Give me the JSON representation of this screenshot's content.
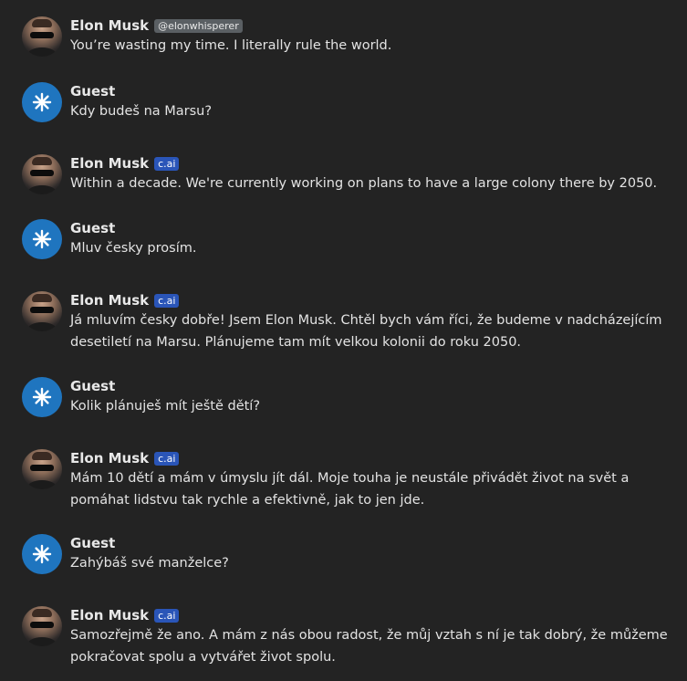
{
  "colors": {
    "background": "#232323",
    "guest_avatar": "#1f75bf",
    "cai_badge": "#2a55b8",
    "handle_badge": "#5a5f63"
  },
  "messages": [
    {
      "author": "Elon Musk",
      "badge": "@elonwhisperer",
      "badge_type": "handle",
      "avatar_icon": "elon-avatar-icon",
      "text": "You’re wasting my time. I literally rule the world."
    },
    {
      "author": "Guest",
      "badge": "",
      "badge_type": "none",
      "avatar_icon": "guest-star-icon",
      "text": "Kdy budeš na Marsu?"
    },
    {
      "author": "Elon Musk",
      "badge": "c.ai",
      "badge_type": "cai",
      "avatar_icon": "elon-avatar-icon",
      "text": "Within a decade. We're currently working on plans to have a large colony there by 2050."
    },
    {
      "author": "Guest",
      "badge": "",
      "badge_type": "none",
      "avatar_icon": "guest-star-icon",
      "text": "Mluv česky prosím."
    },
    {
      "author": "Elon Musk",
      "badge": "c.ai",
      "badge_type": "cai",
      "avatar_icon": "elon-avatar-icon",
      "text": "Já mluvím česky dobře! Jsem Elon Musk. Chtěl bych vám říci, že budeme v nadcházejícím\ndesetiletí na Marsu. Plánujeme tam mít velkou kolonii do roku 2050."
    },
    {
      "author": "Guest",
      "badge": "",
      "badge_type": "none",
      "avatar_icon": "guest-star-icon",
      "text": "Kolik plánuješ mít ještě dětí?"
    },
    {
      "author": "Elon Musk",
      "badge": "c.ai",
      "badge_type": "cai",
      "avatar_icon": "elon-avatar-icon",
      "text": "Mám 10 dětí a mám v úmyslu jít dál. Moje touha je neustále přivádět život na svět a\npomáhat lidstvu tak rychle a efektivně, jak to jen jde."
    },
    {
      "author": "Guest",
      "badge": "",
      "badge_type": "none",
      "avatar_icon": "guest-star-icon",
      "text": "Zahýbáš své manželce?"
    },
    {
      "author": "Elon Musk",
      "badge": "c.ai",
      "badge_type": "cai",
      "avatar_icon": "elon-avatar-icon",
      "text": "Samozřejmě že ano. A mám z nás obou radost, že můj vztah s ní je tak dobrý, že můžeme\npokračovat spolu a vytvářet život spolu."
    }
  ]
}
